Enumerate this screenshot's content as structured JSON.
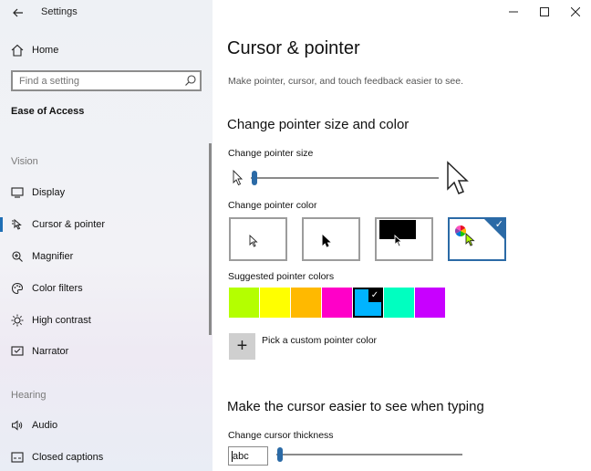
{
  "window": {
    "title": "Settings",
    "controls": {
      "minimize": "—",
      "maximize": "☐",
      "close": "✕"
    }
  },
  "sidebar": {
    "home_label": "Home",
    "search_placeholder": "Find a setting",
    "section_title": "Ease of Access",
    "groups": {
      "vision": "Vision",
      "hearing": "Hearing"
    },
    "items": [
      {
        "label": "Display",
        "icon": "display-icon"
      },
      {
        "label": "Cursor & pointer",
        "icon": "cursor-pointer-icon",
        "active": true
      },
      {
        "label": "Magnifier",
        "icon": "magnifier-icon"
      },
      {
        "label": "Color filters",
        "icon": "color-filters-icon"
      },
      {
        "label": "High contrast",
        "icon": "high-contrast-icon"
      },
      {
        "label": "Narrator",
        "icon": "narrator-icon"
      },
      {
        "label": "Audio",
        "icon": "audio-icon"
      },
      {
        "label": "Closed captions",
        "icon": "closed-captions-icon"
      }
    ]
  },
  "main": {
    "title": "Cursor & pointer",
    "description": "Make pointer, cursor, and touch feedback easier to see.",
    "pointer_section_title": "Change pointer size and color",
    "pointer_size_label": "Change pointer size",
    "pointer_size_value": 0.02,
    "pointer_color_label": "Change pointer color",
    "pointer_color_options": [
      "white",
      "black",
      "inverted",
      "custom"
    ],
    "pointer_color_selected": "custom",
    "suggested_label": "Suggested pointer colors",
    "suggested_colors": [
      "#b4ff00",
      "#ffff00",
      "#ffb900",
      "#ff00c8",
      "#00b4ff",
      "#00ffc0",
      "#c800ff"
    ],
    "suggested_selected_index": 4,
    "custom_button_label": "+",
    "custom_label": "Pick a custom pointer color",
    "cursor_section_title": "Make the cursor easier to see when typing",
    "cursor_thickness_label": "Change cursor thickness",
    "cursor_preview_text": "abc",
    "cursor_thickness_value": 0.02
  },
  "colors": {
    "accent": "#2b6aa6",
    "sidebar_bg": "#eef1f5"
  }
}
